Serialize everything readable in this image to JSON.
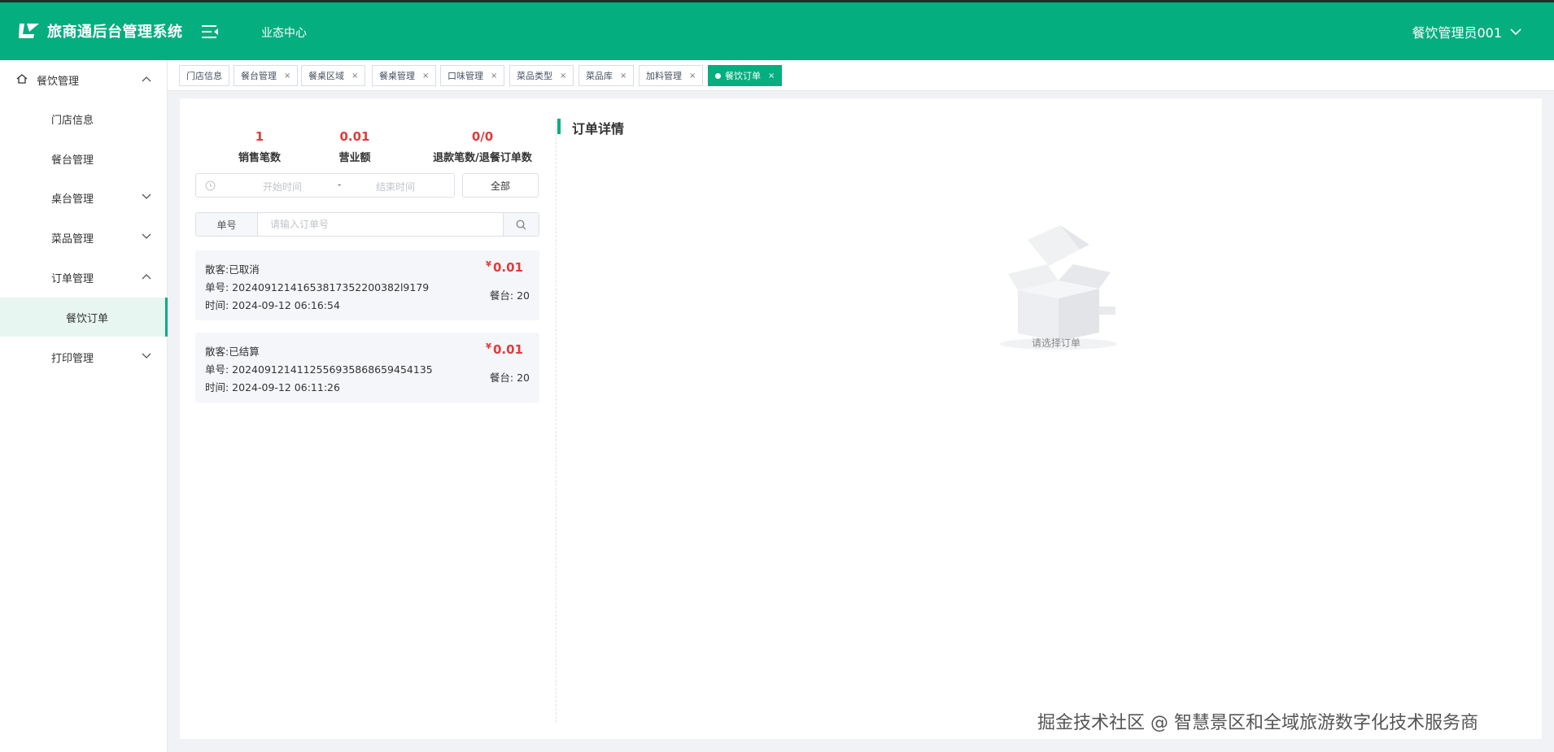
{
  "header": {
    "app_title": "旅商通后台管理系统",
    "center_link": "业态中心",
    "user_name": "餐饮管理员001"
  },
  "sidebar": {
    "root": "餐饮管理",
    "items": [
      {
        "label": "门店信息"
      },
      {
        "label": "餐台管理"
      },
      {
        "label": "桌台管理"
      },
      {
        "label": "菜品管理"
      },
      {
        "label": "订单管理"
      },
      {
        "label": "餐饮订单"
      },
      {
        "label": "打印管理"
      }
    ]
  },
  "tabs": [
    {
      "label": "门店信息"
    },
    {
      "label": "餐台管理"
    },
    {
      "label": "餐桌区域"
    },
    {
      "label": "餐桌管理"
    },
    {
      "label": "口味管理"
    },
    {
      "label": "菜品类型"
    },
    {
      "label": "菜品库"
    },
    {
      "label": "加料管理"
    },
    {
      "label": "餐饮订单"
    }
  ],
  "tab_close": "×",
  "stats": [
    {
      "value": "1",
      "label": "销售笔数"
    },
    {
      "value": "0.01",
      "label": "营业额"
    },
    {
      "value": "0/0",
      "label": "退款笔数/退餐订单数"
    }
  ],
  "filter": {
    "start_placeholder": "开始时间",
    "separator": "-",
    "end_placeholder": "结束时间",
    "all_button": "全部",
    "search_prefix": "单号",
    "search_placeholder": "请输入订单号"
  },
  "orders": [
    {
      "customer": "散客:已取消",
      "order_no": "单号: 20240912141653817352200382l9179",
      "time": "时间: 2024-09-12 06:16:54",
      "currency": "¥",
      "amount": "0.01",
      "table": "餐台: 20"
    },
    {
      "customer": "散客:已结算",
      "order_no": "单号: 20240912141125569358686594541​35",
      "time": "时间: 2024-09-12 06:11:26",
      "currency": "¥",
      "amount": "0.01",
      "table": "餐台: 20"
    }
  ],
  "detail": {
    "title": "订单详情",
    "empty_text": "请选择订单"
  },
  "watermark": "掘金技术社区 @ 智慧景区和全域旅游数字化技术服务商",
  "colors": {
    "brand": "#04ae7f",
    "price": "#e33a3a"
  }
}
